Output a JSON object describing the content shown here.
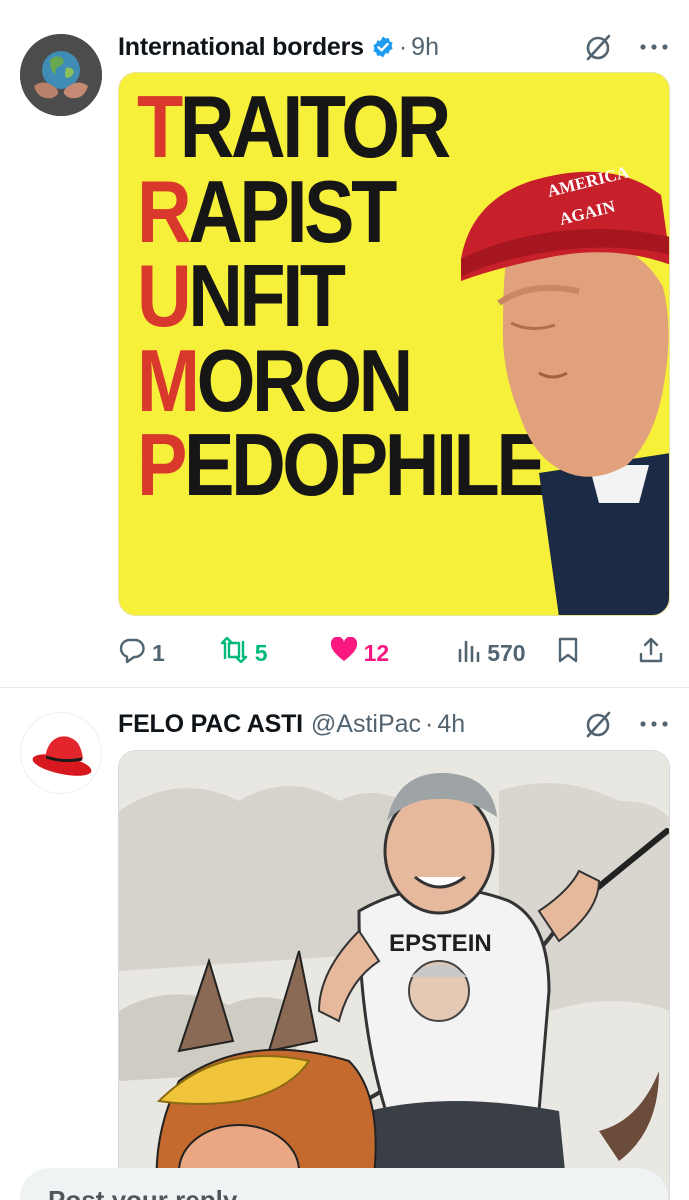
{
  "tweets": [
    {
      "author": {
        "name": "International borders",
        "verified": true
      },
      "time": "9h",
      "media": {
        "poster_lines": [
          {
            "first": "T",
            "rest": "RAITOR"
          },
          {
            "first": "R",
            "rest": "APIST"
          },
          {
            "first": "U",
            "rest": "NFIT"
          },
          {
            "first": "M",
            "rest": "ORON"
          },
          {
            "first": "P",
            "rest": "EDOPHILE"
          }
        ],
        "hat_text": [
          "AMERICA",
          "AGAIN"
        ]
      },
      "stats": {
        "replies": "1",
        "reposts": "5",
        "likes": "12",
        "views": "570"
      }
    },
    {
      "author": {
        "name": "FELO PAC ASTI",
        "handle": "@AstiPac"
      },
      "time": "4h",
      "media": {
        "shirt_text": "EPSTEIN"
      }
    }
  ],
  "reply_placeholder": "Post your reply",
  "colors": {
    "accent": "#1d9bf0",
    "like": "#f91880",
    "repost": "#00ba7c",
    "muted": "#536471",
    "poster_yellow": "#f7f03a",
    "poster_red": "#d8392c"
  },
  "icons": [
    "verified-icon",
    "grok-icon",
    "more-icon",
    "reply-icon",
    "retweet-icon",
    "like-icon",
    "views-icon",
    "bookmark-icon",
    "share-icon"
  ]
}
